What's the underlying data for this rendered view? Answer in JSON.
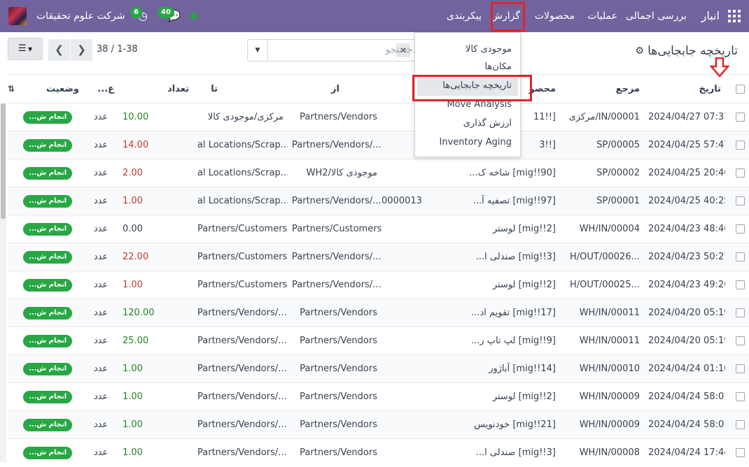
{
  "topbar": {
    "app_name": "انبار",
    "menu": [
      "بررسی اجمالی",
      "عملیات",
      "محصولات",
      "گزارش",
      "پیکربندی"
    ],
    "company": "شرکت علوم تحقیقات",
    "activity_count": "6",
    "messages_count": "40"
  },
  "control": {
    "title": "تاریخچه جابجایی‌ها",
    "search_placeholder": "جستجو...",
    "pager_range": "1-38",
    "pager_total": "38",
    "pager_sep": " / "
  },
  "dropdown": {
    "items": [
      "موجودی کالا",
      "مکان‌ها",
      "تاریخچه جابجایی‌ها",
      "Move Analysis",
      "ارزش گذاری",
      "Inventory Aging"
    ],
    "active_index": 2
  },
  "table": {
    "headers": {
      "date": "تاریخ",
      "reference": "مرجع",
      "product": "محصو",
      "lot": "/شمار...",
      "from": "از",
      "to": "تا",
      "qty": "تعداد",
      "uom": "ع...",
      "status": "وضعیت"
    },
    "rows": [
      {
        "date": "2024/04/27 07:37:...",
        "reference": "مرکزی/IN/00001",
        "product": "[!!11",
        "lot": "",
        "from": "Partners/Vendors",
        "to": "مرکزی/موجودی کالا",
        "qty": "10.00",
        "qty_color": "pos",
        "uom": "عدد",
        "status": "انجام ش..."
      },
      {
        "date": "2024/04/25 57:47:...",
        "reference": "SP/00005",
        "product": "[!!3",
        "lot": "",
        "from": "Partners/Vendors/...",
        "to": "al Locations/Scrap...",
        "qty": "14.00",
        "qty_color": "neg",
        "uom": "عدد",
        "status": "انجام ش..."
      },
      {
        "date": "2024/04/25 20:46:...",
        "reference": "SP/00002",
        "product": "[mig!!90] شاخه ک...",
        "lot": "",
        "from": "WH2/موجودی کالا",
        "to": "al Locations/Scrap...",
        "qty": "2.00",
        "qty_color": "neg",
        "uom": "عدد",
        "status": "انجام ش..."
      },
      {
        "date": "2024/04/25 40:25:...",
        "reference": "SP/00001",
        "product": "[mig!!97] تصفیه آ...",
        "lot": "0000013",
        "from": "Partners/Vendors/...",
        "to": "al Locations/Scrap...",
        "qty": "1.00",
        "qty_color": "neg",
        "uom": "عدد",
        "status": "انجام ش..."
      },
      {
        "date": "2024/04/23 48:46:...",
        "reference": "WH/IN/00004",
        "product": "[mig!!2] لوستر",
        "lot": "",
        "from": "Partners/Customers",
        "to": "Partners/Customers",
        "qty": "0.00",
        "qty_color": "",
        "uom": "عدد",
        "status": "انجام ش..."
      },
      {
        "date": "2024/04/23 50:27:...",
        "reference": "H/OUT/00026...",
        "product": "[mig!!3] صندلی ا...",
        "lot": "",
        "from": "Partners/Vendors/...",
        "to": "Partners/Customers",
        "qty": "22.00",
        "qty_color": "neg",
        "uom": "عدد",
        "status": "انجام ش..."
      },
      {
        "date": "2024/04/23 49:26:...",
        "reference": "H/OUT/00025...",
        "product": "[mig!!2] لوستر",
        "lot": "",
        "from": "Partners/Vendors/...",
        "to": "Partners/Customers",
        "qty": "1.00",
        "qty_color": "neg",
        "uom": "عدد",
        "status": "انجام ش..."
      },
      {
        "date": "2024/04/20 05:19:...",
        "reference": "WH/IN/00011",
        "product": "[mig!!17] تقویم اد...",
        "lot": "",
        "from": "Partners/Vendors",
        "to": "Partners/Vendors/...",
        "qty": "120.00",
        "qty_color": "pos",
        "uom": "عدد",
        "status": "انجام ش..."
      },
      {
        "date": "2024/04/20 05:19:...",
        "reference": "WH/IN/00011",
        "product": "[mig!!9] لپ تاپ ر...",
        "lot": "",
        "from": "Partners/Vendors",
        "to": "Partners/Vendors/...",
        "qty": "25.00",
        "qty_color": "pos",
        "uom": "عدد",
        "status": "انجام ش..."
      },
      {
        "date": "2024/04/24 01:10:...",
        "reference": "WH/IN/00010",
        "product": "[mig!!14] آباژور",
        "lot": "",
        "from": "Partners/Vendors",
        "to": "Partners/Vendors/...",
        "qty": "1.00",
        "qty_color": "pos",
        "uom": "عدد",
        "status": "انجام ش..."
      },
      {
        "date": "2024/04/24 58:01:...",
        "reference": "WH/IN/00009",
        "product": "[mig!!2] لوستر",
        "lot": "",
        "from": "Partners/Vendors",
        "to": "Partners/Vendors/...",
        "qty": "1.00",
        "qty_color": "pos",
        "uom": "عدد",
        "status": "انجام ش..."
      },
      {
        "date": "2024/04/24 58:01:...",
        "reference": "WH/IN/00009",
        "product": "[mig!!21] خودنویس",
        "lot": "",
        "from": "Partners/Vendors",
        "to": "Partners/Vendors/...",
        "qty": "1.00",
        "qty_color": "pos",
        "uom": "عدد",
        "status": "انجام ش..."
      },
      {
        "date": "2024/04/24 17:44:...",
        "reference": "WH/IN/00008",
        "product": "[mig!!3] صندلی ا...",
        "lot": "",
        "from": "Partners/Vendors",
        "to": "Partners/Vendors/...",
        "qty": "1.00",
        "qty_color": "pos",
        "uom": "عدد",
        "status": "انجام ش..."
      }
    ]
  },
  "colors": {
    "topbar": "#71639e",
    "status": "#28a745",
    "highlight": "#e0242b"
  }
}
